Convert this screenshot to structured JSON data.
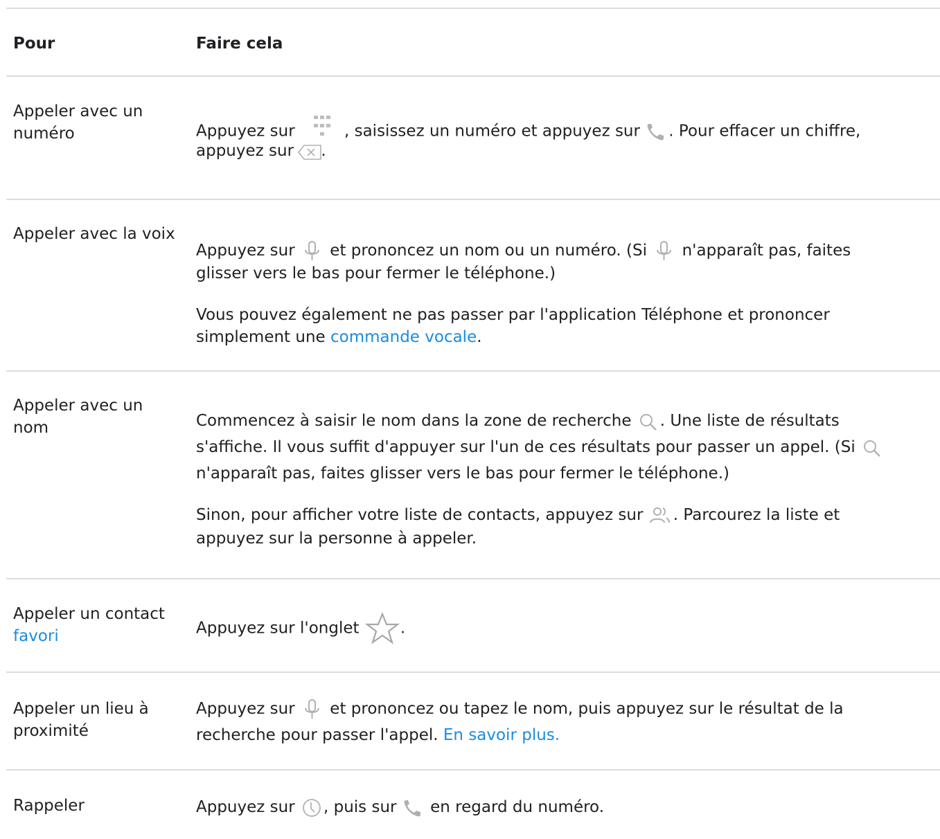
{
  "header": {
    "col1": "Pour",
    "col2": "Faire cela"
  },
  "rows": [
    {
      "label_line1": "Appeler avec un",
      "label_line2": "numéro",
      "line1_a": "Appuyez sur",
      "line1_b": ", saisissez un numéro et appuyez sur",
      "line1_c": ". Pour effacer un chiffre,",
      "line2_a": "appuyez sur",
      "line2_b": ".",
      "icons": [
        "dialpad-icon",
        "phone-icon",
        "backspace-icon"
      ]
    },
    {
      "label": "Appeler avec la voix",
      "line1_a": "Appuyez sur",
      "line1_b": "et prononcez un nom ou un numéro. (Si",
      "line1_c": "n'apparaît pas, faites",
      "line2": "glisser vers le bas pour fermer le téléphone.)",
      "para2_line1": "Vous pouvez également ne pas passer par l'application Téléphone et prononcer",
      "para2_line2_a": "simplement une",
      "para2_link": "commande vocale",
      "para2_line2_b": ".",
      "icons": [
        "microphone-icon",
        "microphone-icon"
      ]
    },
    {
      "label_line1": "Appeler avec un",
      "label_line2": "nom",
      "line1_a": "Commencez à saisir le nom dans la zone de recherche",
      "line1_b": ". Une liste de résultats",
      "line2_a": "s'affiche. Il vous suffit d'appuyer sur l'un de ces résultats pour passer un appel. (Si",
      "line3": "n'apparaît pas, faites glisser vers le bas pour fermer le téléphone.)",
      "para2_line1_a": "Sinon, pour afficher votre liste de contacts, appuyez sur",
      "para2_line1_b": ". Parcourez la liste et",
      "para2_line2": "appuyez sur la personne à appeler.",
      "icons": [
        "search-icon",
        "search-icon",
        "contacts-icon"
      ]
    },
    {
      "label_line1": "Appeler un contact",
      "label_link": "favori",
      "line1_a": "Appuyez sur l'onglet",
      "line1_b": ".",
      "icons": [
        "star-icon"
      ]
    },
    {
      "label_line1": "Appeler un lieu à",
      "label_line2": "proximité",
      "line1_a": "Appuyez sur",
      "line1_b": "et prononcez ou tapez le nom, puis appuyez sur le résultat de la",
      "line2_a": "recherche pour passer l'appel.",
      "line2_link": "En savoir plus.",
      "icons": [
        "microphone-icon"
      ]
    },
    {
      "label": "Rappeler",
      "line1_a": "Appuyez sur",
      "line1_b": ", puis sur",
      "line1_c": "en regard du numéro.",
      "icons": [
        "clock-icon",
        "phone-icon"
      ]
    }
  ],
  "colors": {
    "text": "#202124",
    "link": "#1a8ce0",
    "rule": "#dadce0",
    "icon": "#9aa0a6"
  }
}
